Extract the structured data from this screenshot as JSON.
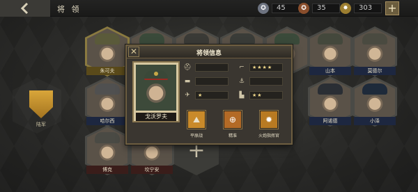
{
  "header": {
    "title": "将 领",
    "resources": [
      {
        "icon": "silver-medal-icon",
        "value": "45",
        "color": "#8a8f98"
      },
      {
        "icon": "bronze-medal-icon",
        "value": "35",
        "color": "#a0603a"
      },
      {
        "icon": "gold-star-medal-icon",
        "value": "303",
        "color": "#c8a848"
      }
    ],
    "add_label": "+"
  },
  "sidebar": {
    "badge_label": "陆军"
  },
  "generals": [
    {
      "name": "朱可夫",
      "style": "gold"
    },
    {
      "name": "",
      "style": "blue"
    },
    {
      "name": "",
      "style": "blue"
    },
    {
      "name": "",
      "style": "blue"
    },
    {
      "name": "",
      "style": "blue"
    },
    {
      "name": "山本",
      "style": "blue"
    },
    {
      "name": "莫德尔",
      "style": "blue"
    },
    {
      "name": "哈尔西",
      "style": "blue"
    },
    {
      "name": "阿诺德",
      "style": "blue"
    },
    {
      "name": "小泽",
      "style": "blue"
    },
    {
      "name": "博克",
      "style": "red"
    },
    {
      "name": "坎宁安",
      "style": "red"
    }
  ],
  "modal": {
    "title": "将领信息",
    "close_label": "✕",
    "general_name": "戈沃罗夫",
    "stats": {
      "infantry": "",
      "tank": "",
      "air": "★",
      "artillery": "★★★★",
      "navy": "",
      "defense": "★★"
    },
    "skills": [
      {
        "label": "平原战",
        "icon": "plains-icon"
      },
      {
        "label": "精准",
        "icon": "crosshair-icon"
      },
      {
        "label": "火炮指挥官",
        "icon": "artillery-commander-icon"
      }
    ]
  }
}
